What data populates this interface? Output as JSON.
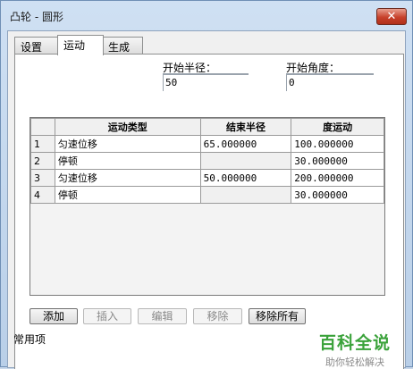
{
  "window": {
    "title": "凸轮 - 圆形",
    "close_glyph": "✕"
  },
  "tabs": [
    {
      "label": "设置"
    },
    {
      "label": "运动"
    },
    {
      "label": "生成"
    }
  ],
  "fields": {
    "start_radius_label": "开始半径：",
    "start_radius_value": "50",
    "start_angle_label": "开始角度：",
    "start_angle_value": "0"
  },
  "table": {
    "headers": [
      "",
      "运动类型",
      "结束半径",
      "度运动"
    ],
    "rows": [
      {
        "num": "1",
        "type": "匀速位移",
        "end_radius": "65.000000",
        "degrees": "100.000000"
      },
      {
        "num": "2",
        "type": "停顿",
        "end_radius": "",
        "degrees": "30.000000"
      },
      {
        "num": "3",
        "type": "匀速位移",
        "end_radius": "50.000000",
        "degrees": "200.000000"
      },
      {
        "num": "4",
        "type": "停顿",
        "end_radius": "",
        "degrees": "30.000000"
      }
    ]
  },
  "buttons": {
    "add": "添加",
    "insert": "插入",
    "edit": "编辑",
    "remove": "移除",
    "remove_all": "移除所有"
  },
  "watermark": {
    "main": "百科全说",
    "sub": "助你轻松解决"
  },
  "bottom": {
    "label": "常用项"
  },
  "colors": {
    "close_red": "#c7412b",
    "watermark_green": "#3aa23a"
  }
}
